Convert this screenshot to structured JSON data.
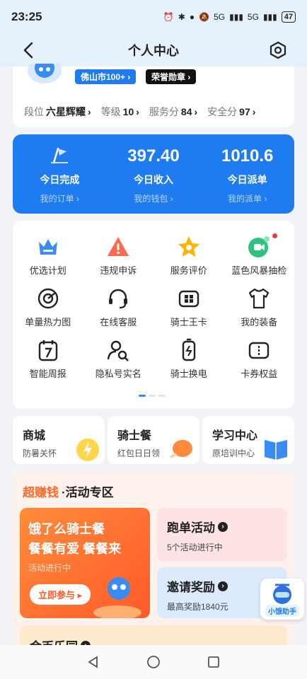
{
  "status_bar": {
    "time": "23:25",
    "signal1": "5G",
    "signal2": "5G",
    "battery": "47"
  },
  "header": {
    "title": "个人中心"
  },
  "profile": {
    "city_badge": "佛山市100+ ›",
    "honor_badge": "荣誉勋章 ›",
    "stats": [
      {
        "label": "段位",
        "value": "六星辉耀"
      },
      {
        "label": "等级",
        "value": "10"
      },
      {
        "label": "服务分",
        "value": "84"
      },
      {
        "label": "安全分",
        "value": "97"
      }
    ]
  },
  "summary": [
    {
      "value": "",
      "label": "今日完成",
      "link": "我的订单 ›"
    },
    {
      "value": "397.40",
      "label": "今日收入",
      "link": "我的钱包 ›"
    },
    {
      "value": "1010.6",
      "label": "今日派单",
      "link": "我的派单 ›"
    }
  ],
  "services": [
    {
      "label": "优选计划",
      "icon": "crown-icon"
    },
    {
      "label": "违规申诉",
      "icon": "warning-icon"
    },
    {
      "label": "服务评价",
      "icon": "star-icon"
    },
    {
      "label": "蓝色风暴抽检",
      "icon": "video-check-icon"
    },
    {
      "label": "单量热力图",
      "icon": "heatmap-target-icon"
    },
    {
      "label": "在线客服",
      "icon": "headset-icon"
    },
    {
      "label": "骑士王卡",
      "icon": "card-icon"
    },
    {
      "label": "我的装备",
      "icon": "shirt-icon"
    },
    {
      "label": "智能周报",
      "icon": "calendar-icon"
    },
    {
      "label": "隐私号实名",
      "icon": "user-search-icon"
    },
    {
      "label": "骑士换电",
      "icon": "battery-swap-icon"
    },
    {
      "label": "卡券权益",
      "icon": "coupon-icon"
    }
  ],
  "mini_cards": [
    {
      "title": "商城",
      "subtitle": "防暑关怀"
    },
    {
      "title": "骑士餐",
      "subtitle": "红包日日领"
    },
    {
      "title": "学习中心",
      "subtitle": "原培训中心"
    }
  ],
  "activity": {
    "title_highlight": "超赚钱",
    "title_rest": "·活动专区",
    "promo": {
      "line1": "饿了么骑士餐",
      "line2": "餐餐有爱 餐餐来",
      "status": "活动进行中",
      "button": "立即参与 ▸"
    },
    "run": {
      "title": "跑单活动",
      "subtitle": "5个活动进行中"
    },
    "invite": {
      "title": "邀请奖励",
      "subtitle": "最高奖励1840元"
    },
    "coin": {
      "title": "金币乐园"
    }
  },
  "assistant": {
    "label": "小饿助手"
  },
  "colors": {
    "brand_blue": "#1e7cf0",
    "accent_orange": "#ff6a2a"
  }
}
